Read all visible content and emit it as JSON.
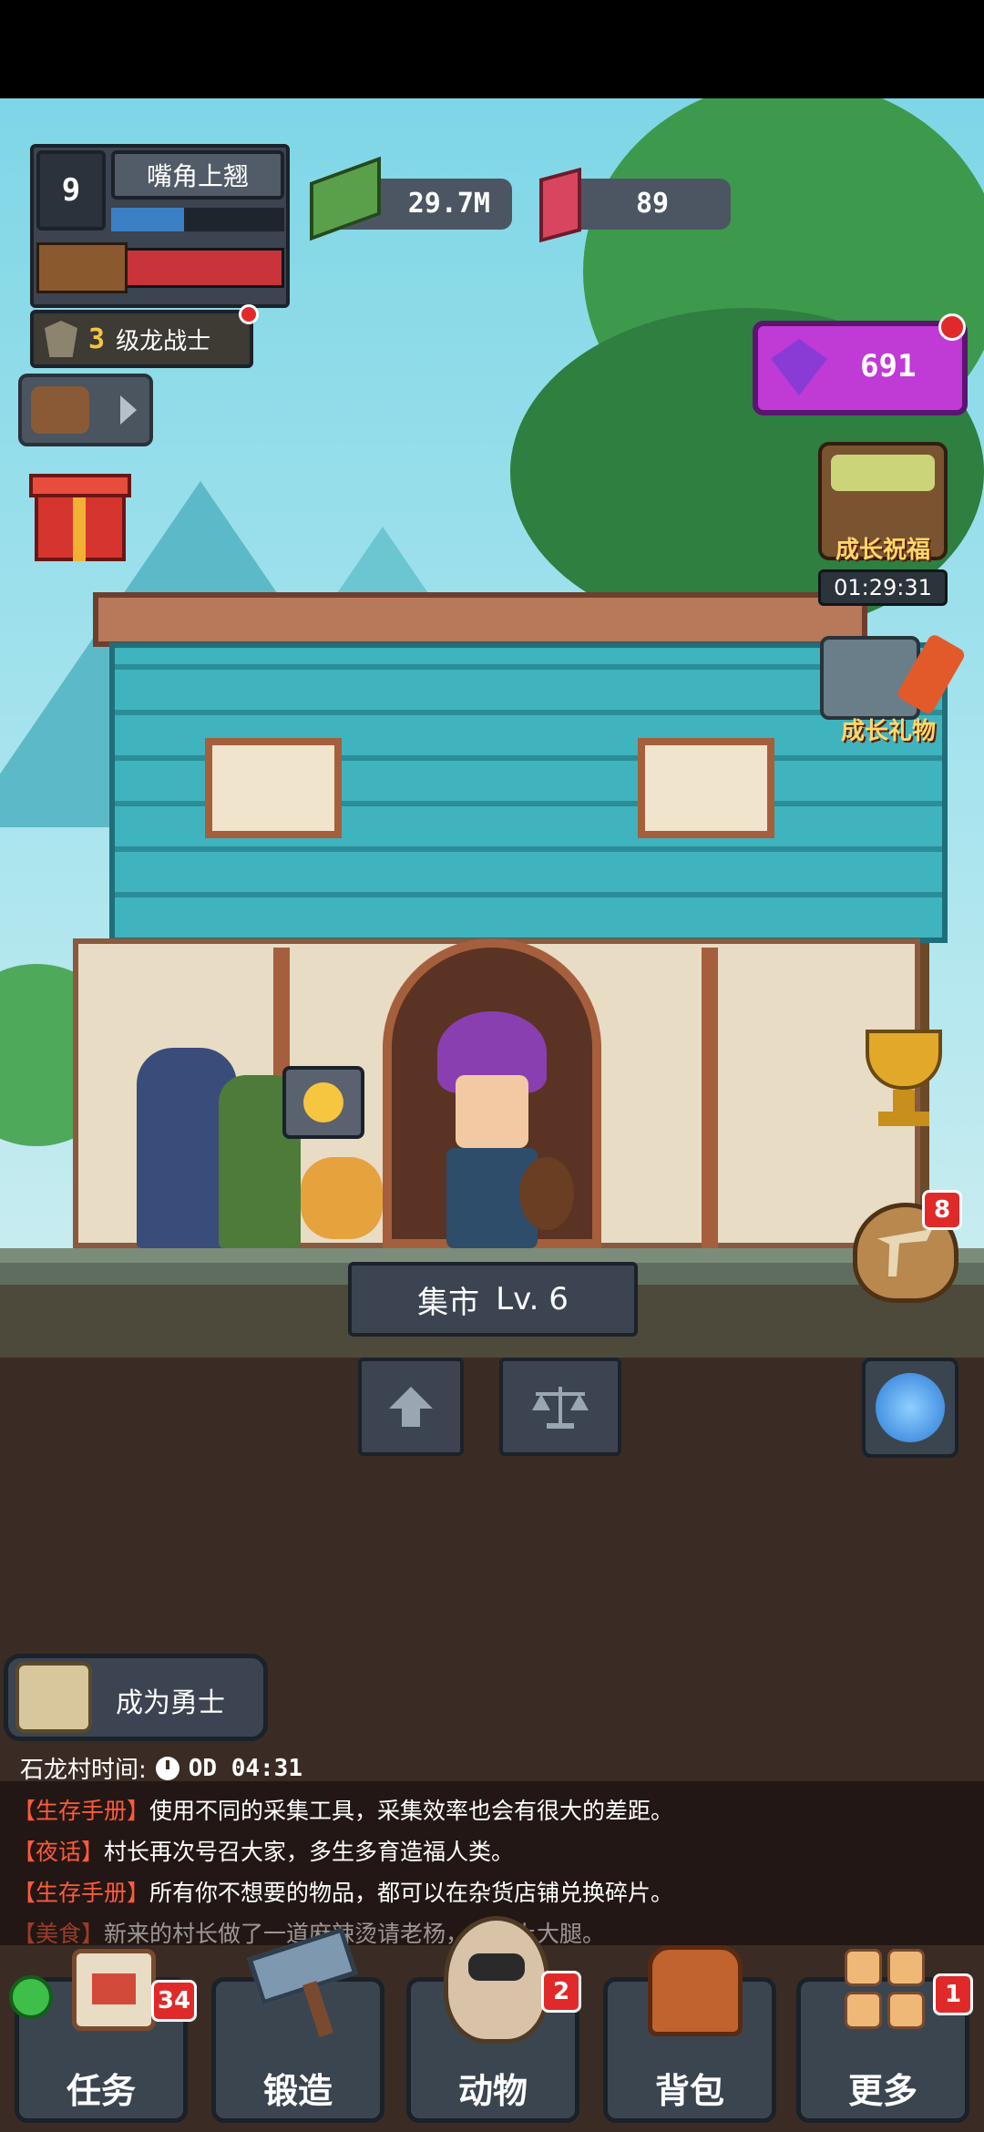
{
  "player": {
    "level": "9",
    "title": "嘴角上翘",
    "rank_level": "3",
    "rank_name": "级龙战士"
  },
  "currency": {
    "cash": "29.7M",
    "gems": "89"
  },
  "right_panel": {
    "gem_pack_value": "691",
    "growth_blessing_label": "成长祝福",
    "growth_blessing_timer": "01:29:31",
    "growth_gift_label": "成长礼物",
    "pickaxe_badge": "8"
  },
  "building": {
    "name": "集市",
    "level": "Lv. 6"
  },
  "quest": {
    "label": "成为勇士"
  },
  "village": {
    "time_label": "石龙村时间:",
    "time_value": "OD 04:31"
  },
  "chat": [
    {
      "tag": "【生存手册】",
      "text": "使用不同的采集工具，采集效率也会有很大的差距。"
    },
    {
      "tag": "【夜话】",
      "text": "村长再次号召大家，多生多育造福人类。"
    },
    {
      "tag": "【生存手册】",
      "text": "所有你不想要的物品，都可以在杂货店铺兑换碎片。"
    },
    {
      "tag": "【美食】",
      "text": "新来的村长做了一道麻辣烫请老杨，动抱上大腿。"
    }
  ],
  "nav": [
    {
      "label": "任务",
      "badge": "34"
    },
    {
      "label": "锻造",
      "badge": ""
    },
    {
      "label": "动物",
      "badge": "2"
    },
    {
      "label": "背包",
      "badge": ""
    },
    {
      "label": "更多",
      "badge": "1"
    }
  ],
  "colors": {
    "badge_red": "#e02a2a",
    "chat_tag": "#ff5a3a",
    "roof_teal": "#3fb3be",
    "gem_purple": "#c03ad6"
  }
}
